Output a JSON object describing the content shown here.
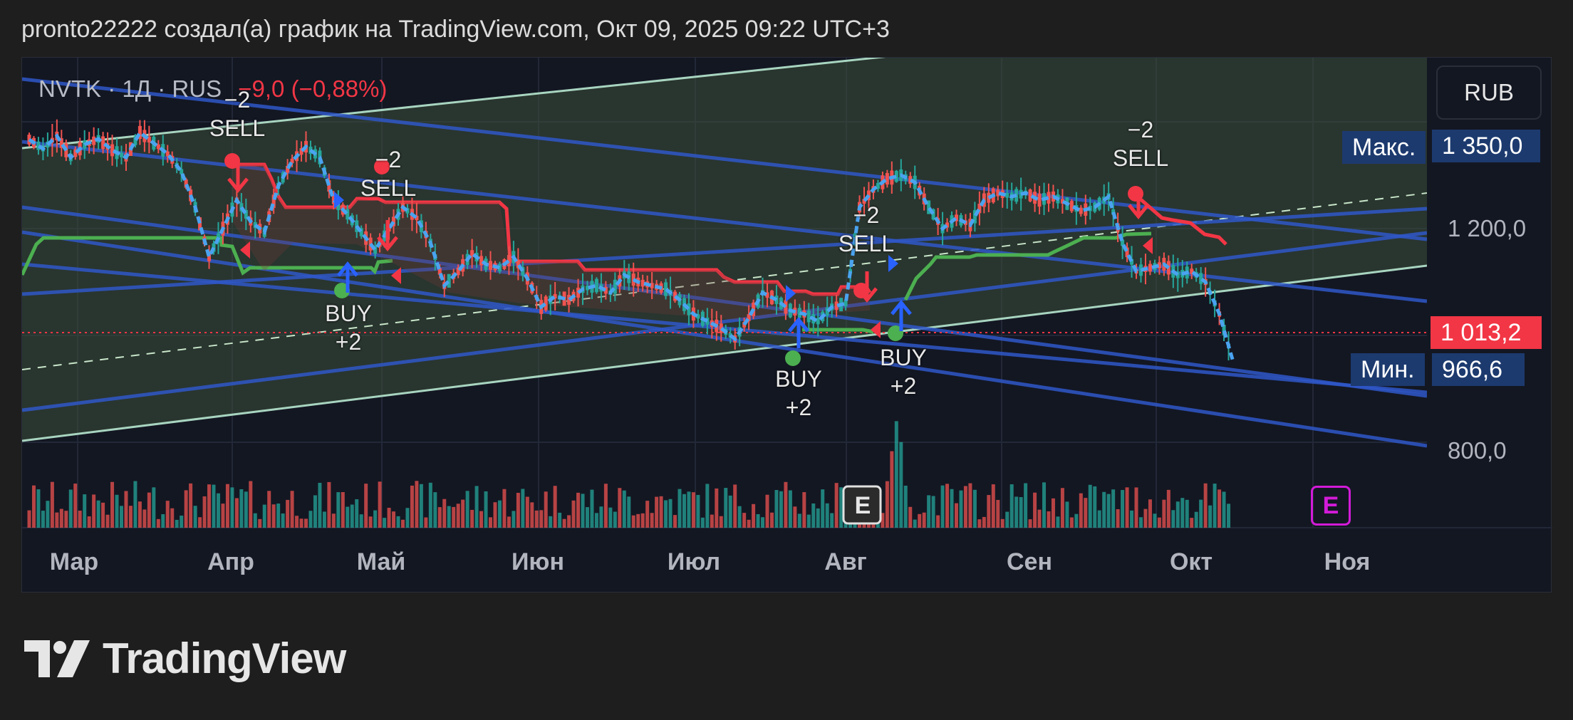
{
  "header": "pronto22222 создал(а) график на TradingView.com, Окт 09, 2025 09:22 UTC+3",
  "legend": {
    "symbol": "NVTK",
    "sep": "·",
    "interval": "1Д",
    "exchange": "RUS",
    "change": "−9,0 (−0,88%)"
  },
  "currency_button": "RUB",
  "price_axis": {
    "max_label": "Макс.",
    "max_value": "1 350,0",
    "tick_1200": "1 200,0",
    "last_value": "1 013,2",
    "min_label": "Мин.",
    "min_value": "966,6",
    "tick_800": "800,0"
  },
  "months": [
    "Мар",
    "Апр",
    "Май",
    "Июн",
    "Июл",
    "Авг",
    "Сен",
    "Окт",
    "Ноя"
  ],
  "signals": [
    {
      "label": "−2\nSELL"
    },
    {
      "label": "−2\nSELL"
    },
    {
      "label": "BUY\n+2"
    },
    {
      "label": "−2\nSELL"
    },
    {
      "label": "BUY\n+2"
    },
    {
      "label": "BUY\n+2"
    },
    {
      "label": "−2\nSELL"
    }
  ],
  "earnings_badges": [
    "E",
    "E"
  ],
  "logo_text": "TradingView",
  "colors": {
    "up": "#26a69a",
    "down": "#ef5350",
    "price_line": "#4aa3f0",
    "stop_red": "#f23645",
    "stop_green": "#4caf50",
    "channel_blue": "#2f57c8",
    "channel_fill": "#3d4f3b",
    "signal_arrow": "#2962ff",
    "max_min_tag": "#1c3a6e",
    "last_price_tag": "#f23645",
    "earnings_future": "#d21bd8"
  },
  "chart_data": {
    "type": "line",
    "instrument": "NVTK",
    "interval": "1Д",
    "x": [
      "Мар",
      "Апр",
      "Май",
      "Июн",
      "Июл",
      "Авг",
      "Сен",
      "Окт",
      "Ноя"
    ],
    "series": [
      {
        "values": [
          1325,
          1312,
          1330,
          1300,
          1318,
          1326,
          1310,
          1300,
          1335,
          1320,
          1305,
          1280,
          1230,
          1160,
          1200,
          1240,
          1210,
          1195,
          1260,
          1295,
          1315,
          1300,
          1240,
          1220,
          1195,
          1170,
          1200,
          1230,
          1215,
          1180,
          1120,
          1140,
          1165,
          1150,
          1145,
          1160,
          1130,
          1090,
          1105,
          1100,
          1115,
          1120,
          1110,
          1135,
          1125,
          1120,
          1115,
          1100,
          1080,
          1070,
          1060,
          1045,
          1075,
          1110,
          1100,
          1085,
          1080,
          1070,
          1090,
          1095,
          1230,
          1255,
          1270,
          1275,
          1265,
          1230,
          1200,
          1215,
          1205,
          1240,
          1250,
          1245,
          1250,
          1240,
          1245,
          1235,
          1225,
          1230,
          1245,
          1180,
          1140,
          1145,
          1150,
          1135,
          1140,
          1125,
          1080,
          1013
        ]
      }
    ],
    "y_ticks": [
      "1 350,0",
      "1 200,0",
      "1 013,2",
      "966,6",
      "800,0"
    ],
    "max": 1350.0,
    "min": 966.6,
    "last": 1013.2,
    "change": "−9,0 (−0,88%)",
    "signals": [
      {
        "type": "SELL",
        "qty": -2,
        "month_pos": "Апр"
      },
      {
        "type": "SELL",
        "qty": -2,
        "month_pos": "Май"
      },
      {
        "type": "BUY",
        "qty": 2,
        "month_pos": "Апр"
      },
      {
        "type": "SELL",
        "qty": -2,
        "month_pos": "Авг"
      },
      {
        "type": "BUY",
        "qty": 2,
        "month_pos": "Июл"
      },
      {
        "type": "BUY",
        "qty": 2,
        "month_pos": "Авг"
      },
      {
        "type": "SELL",
        "qty": -2,
        "month_pos": "Сен"
      }
    ],
    "grid": true
  }
}
